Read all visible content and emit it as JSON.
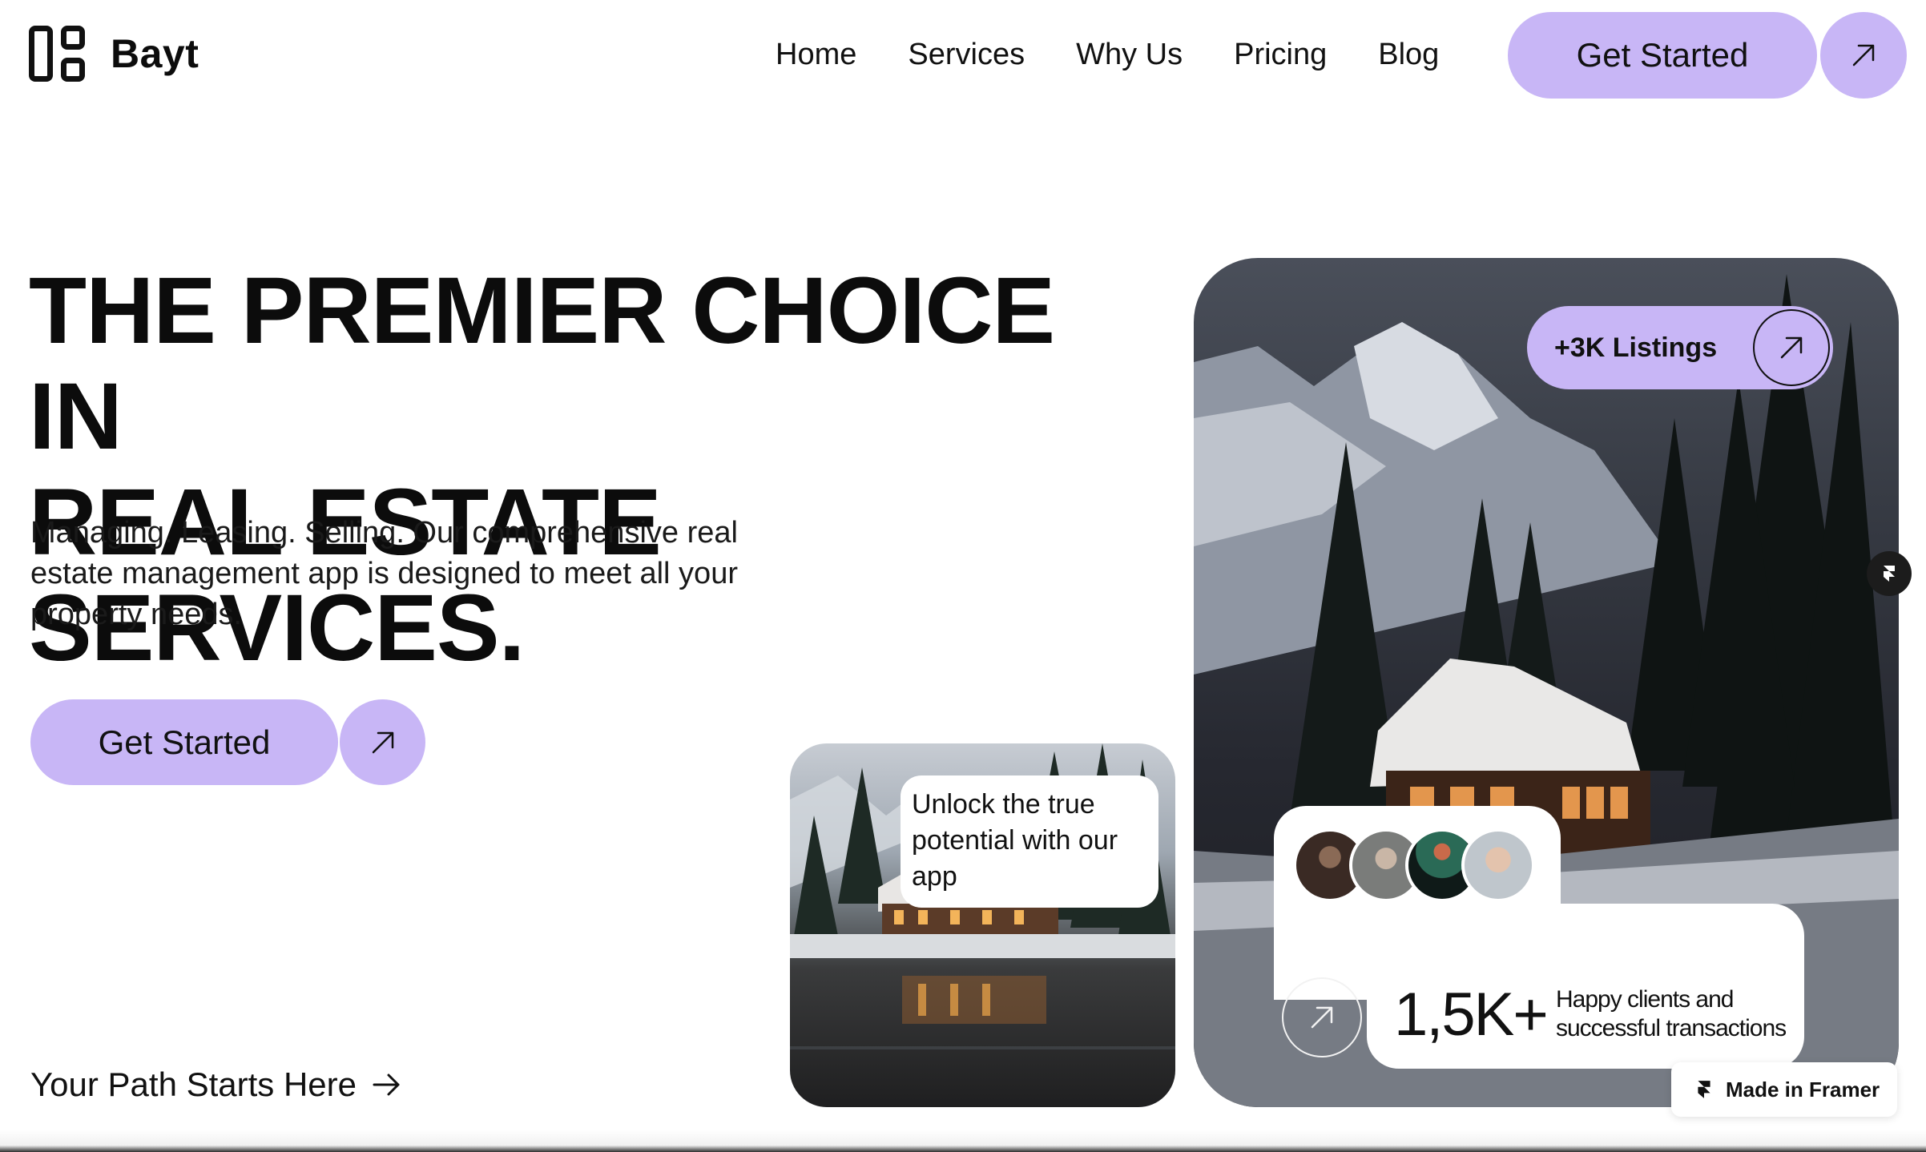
{
  "brand": {
    "name": "Bayt",
    "logo_icon": "grid-logo-icon"
  },
  "nav": {
    "items": [
      {
        "label": "Home"
      },
      {
        "label": "Services"
      },
      {
        "label": "Why Us"
      },
      {
        "label": "Pricing"
      },
      {
        "label": "Blog"
      }
    ],
    "cta_label": "Get Started",
    "cta_icon": "arrow-up-right-icon"
  },
  "hero": {
    "title_line1": "THE PREMIER CHOICE IN",
    "title_line2": "REAL ESTATE SERVICES.",
    "subtitle": "Managing. Leasing. Selling. Our comprehensive real estate management app is designed to meet all your property needs.",
    "cta_label": "Get Started",
    "cta_icon": "arrow-up-right-icon",
    "path_link": "Your Path Starts Here",
    "path_icon": "arrow-right-icon"
  },
  "small_card": {
    "bubble_text": "Unlock the true potential with our app"
  },
  "big_card": {
    "listings_label": "+3K Listings",
    "listings_icon": "arrow-up-right-icon",
    "stats_number": "1,5K+",
    "stats_caption": "Happy clients and successful transactions",
    "stats_icon": "arrow-up-right-icon"
  },
  "framer": {
    "badge_label": "Made in Framer",
    "icon": "framer-icon"
  },
  "colors": {
    "accent": "#c8b6f6",
    "text": "#0c0c0c",
    "background": "#ffffff"
  }
}
